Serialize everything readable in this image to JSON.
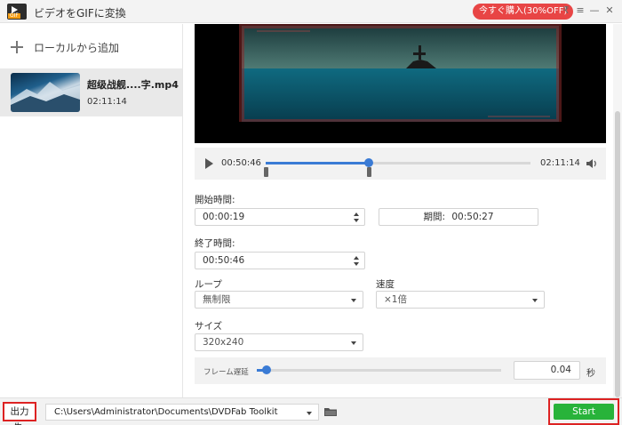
{
  "window": {
    "title": "ビデオをGIFに変換",
    "logo_tag": "GIF",
    "promo_label": "今すぐ購入(30%OFF)",
    "pin_glyph": "₹",
    "menu_glyph": "≡",
    "minimize_glyph": "—",
    "maximize_glyph": "□",
    "close_glyph": "✕"
  },
  "sidebar": {
    "add_label": "ローカルから追加",
    "files": [
      {
        "name": "超级战舰....字.mp4",
        "duration": "02:11:14"
      }
    ]
  },
  "player": {
    "current_time": "00:50:46",
    "total_time": "02:11:14",
    "progress_fraction": 0.39,
    "clip_start_fraction": 0.0,
    "clip_end_fraction": 0.39
  },
  "settings": {
    "start_label": "開始時間:",
    "start_value": "00:00:19",
    "period_label": "期間:",
    "period_value": "00:50:27",
    "end_label": "終了時間:",
    "end_value": "00:50:46",
    "loop_label": "ループ",
    "loop_value": "無制限",
    "speed_label": "速度",
    "speed_value": "×1倍",
    "size_label": "サイズ",
    "size_value": "320x240",
    "delay_label": "フレーム遅延",
    "delay_value": "0.04",
    "delay_unit": "秒",
    "delay_fraction": 0.04
  },
  "output": {
    "label": "出力先:",
    "path": "C:\\Users\\Administrator\\Documents\\DVDFab Toolkit",
    "start_label": "Start"
  },
  "colors": {
    "accent": "#3a7bd5",
    "start": "#28b33a",
    "highlight": "#dd2222",
    "promo": "#e84545"
  }
}
